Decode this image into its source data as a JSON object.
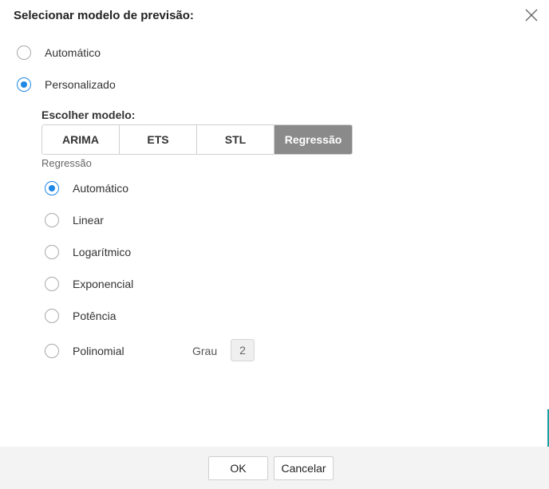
{
  "dialog": {
    "title": "Selecionar modelo de previsão:",
    "close_icon": "close-icon"
  },
  "mode": {
    "options": [
      {
        "label": "Automático",
        "checked": false
      },
      {
        "label": "Personalizado",
        "checked": true
      }
    ]
  },
  "model": {
    "label": "Escolher modelo:",
    "tabs": [
      {
        "label": "ARIMA",
        "active": false
      },
      {
        "label": "ETS",
        "active": false
      },
      {
        "label": "STL",
        "active": false
      },
      {
        "label": "Regressão",
        "active": true
      }
    ]
  },
  "regression": {
    "label": "Regressão",
    "options": [
      {
        "label": "Automático",
        "checked": true
      },
      {
        "label": "Linear",
        "checked": false
      },
      {
        "label": "Logarítmico",
        "checked": false
      },
      {
        "label": "Exponencial",
        "checked": false
      },
      {
        "label": "Potência",
        "checked": false
      },
      {
        "label": "Polinomial",
        "checked": false
      }
    ],
    "degree_label": "Grau",
    "degree_value": "2"
  },
  "footer": {
    "ok_label": "OK",
    "cancel_label": "Cancelar"
  },
  "colors": {
    "accent": "#1e88e5",
    "active_tab": "#8a8a8a",
    "footer_bg": "#f3f3f3"
  }
}
